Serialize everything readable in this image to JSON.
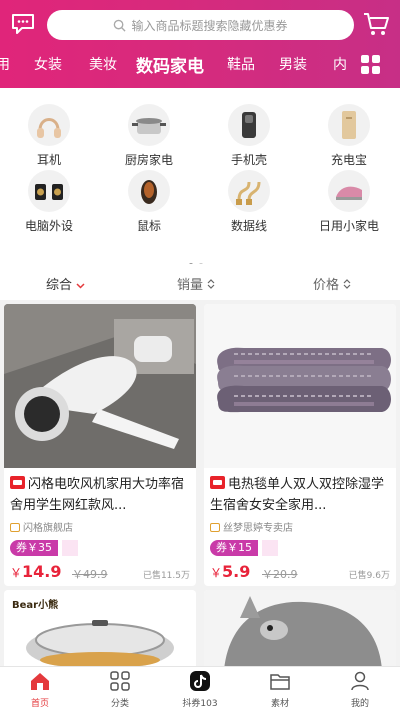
{
  "search": {
    "placeholder": "输入商品标题搜索隐藏优惠券"
  },
  "categories": [
    "用",
    "女装",
    "美妆",
    "数码家电",
    "鞋品",
    "男装",
    "内"
  ],
  "subcategories": [
    "耳机",
    "厨房家电",
    "手机壳",
    "充电宝",
    "电脑外设",
    "鼠标",
    "数据线",
    "日用小家电"
  ],
  "sort": {
    "comprehensive": "综合",
    "sales": "销量",
    "price": "价格"
  },
  "products": [
    {
      "title": "闪格电吹风机家用大功率宿舍用学生网红款风...",
      "shop": "闪格旗舰店",
      "coupon": "券￥35",
      "currency": "￥",
      "price": "14.9",
      "original": "￥49.9",
      "sold": "已售11.5万"
    },
    {
      "title": "电热毯单人双人双控除湿学生宿舍女安全家用...",
      "shop": "丝梦思婷专卖店",
      "coupon": "券￥15",
      "currency": "￥",
      "price": "5.9",
      "original": "￥20.9",
      "sold": "已售9.6万"
    }
  ],
  "brand_logo": "Bear小熊",
  "tabs": [
    {
      "label": "首页",
      "icon": "home-icon"
    },
    {
      "label": "分类",
      "icon": "category-grid-icon"
    },
    {
      "label": "抖券103",
      "icon": "douyin-icon"
    },
    {
      "label": "素材",
      "icon": "folder-icon"
    },
    {
      "label": "我的",
      "icon": "user-icon"
    }
  ],
  "colors": {
    "accent": "#e0257a",
    "price": "#e8233a",
    "coupon": "#c93aa8"
  }
}
